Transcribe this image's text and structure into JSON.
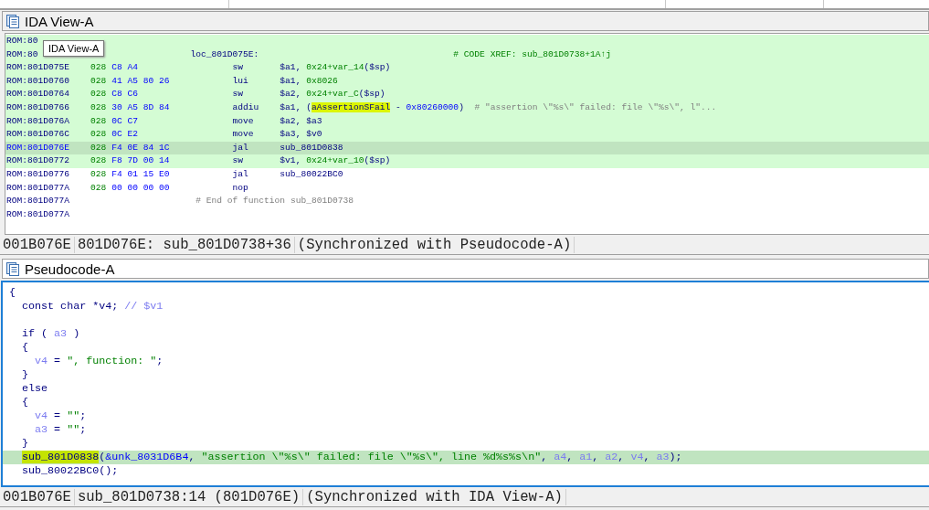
{
  "ida_view": {
    "title": "IDA View-A",
    "active": false,
    "tooltip": "IDA View-A",
    "lines": [
      {
        "kind": "plain",
        "marked": true,
        "selected": false,
        "addr": "ROM:80"
      },
      {
        "kind": "label",
        "marked": true,
        "selected": false,
        "addr": "ROM:80",
        "label": "loc_801D075E:",
        "comment": {
          "kind": "xref",
          "text": "# CODE XREF: sub_801D0738+1A↑j"
        }
      },
      {
        "kind": "insn",
        "marked": true,
        "selected": false,
        "addr": "ROM:801D075E",
        "prefix": "028",
        "bytes": "C8 A4",
        "mnem": "sw",
        "ops": [
          {
            "text": "$a1, ",
            "kind": "reg"
          },
          {
            "text": "0x24+var_14",
            "kind": "num"
          },
          {
            "text": "($sp)",
            "kind": "reg"
          }
        ]
      },
      {
        "kind": "insn",
        "marked": true,
        "selected": false,
        "addr": "ROM:801D0760",
        "prefix": "028",
        "bytes": "41 A5 80 26",
        "mnem": "lui",
        "ops": [
          {
            "text": "$a1, ",
            "kind": "reg"
          },
          {
            "text": "0x8026",
            "kind": "num"
          }
        ]
      },
      {
        "kind": "insn",
        "marked": true,
        "selected": false,
        "addr": "ROM:801D0764",
        "prefix": "028",
        "bytes": "C8 C6",
        "mnem": "sw",
        "ops": [
          {
            "text": "$a2, ",
            "kind": "reg"
          },
          {
            "text": "0x24+var_C",
            "kind": "num"
          },
          {
            "text": "($sp)",
            "kind": "reg"
          }
        ]
      },
      {
        "kind": "insn",
        "marked": true,
        "selected": false,
        "addr": "ROM:801D0766",
        "prefix": "028",
        "bytes": "30 A5 8D 84",
        "mnem": "addiu",
        "ops": [
          {
            "text": "$a1, (",
            "kind": "reg"
          },
          {
            "text": "aAssertionSFail",
            "kind": "reg",
            "highlighted": true
          },
          {
            "text": " - ",
            "kind": "reg"
          },
          {
            "text": "0x80260000",
            "kind": "addr"
          },
          {
            "text": ")",
            "kind": "reg"
          }
        ],
        "comment": {
          "kind": "string",
          "text": "# \"assertion \\\"%s\\\" failed: file \\\"%s\\\", l\"..."
        }
      },
      {
        "kind": "insn",
        "marked": true,
        "selected": false,
        "addr": "ROM:801D076A",
        "prefix": "028",
        "bytes": "0C C7",
        "mnem": "move",
        "ops": [
          {
            "text": "$a2, $a3",
            "kind": "reg"
          }
        ]
      },
      {
        "kind": "insn",
        "marked": true,
        "selected": false,
        "addr": "ROM:801D076C",
        "prefix": "028",
        "bytes": "0C E2",
        "mnem": "move",
        "ops": [
          {
            "text": "$a3, $v0",
            "kind": "reg"
          }
        ]
      },
      {
        "kind": "insn",
        "marked": true,
        "selected": true,
        "addr": "ROM:801D076E",
        "prefix": "028",
        "bytes": "F4 0E 84 1C",
        "mnem": "jal",
        "ops": [
          {
            "text": "sub_801D0838",
            "kind": "reg"
          }
        ]
      },
      {
        "kind": "insn",
        "marked": true,
        "selected": false,
        "addr": "ROM:801D0772",
        "prefix": "028",
        "bytes": "F8 7D 00 14",
        "mnem": "sw",
        "ops": [
          {
            "text": "$v1, ",
            "kind": "reg"
          },
          {
            "text": "0x24+var_10",
            "kind": "num"
          },
          {
            "text": "($sp)",
            "kind": "reg"
          }
        ]
      },
      {
        "kind": "insn",
        "marked": false,
        "selected": false,
        "addr": "ROM:801D0776",
        "prefix": "028",
        "bytes": "F4 01 15 E0",
        "mnem": "jal",
        "ops": [
          {
            "text": "sub_80022BC0",
            "kind": "reg"
          }
        ]
      },
      {
        "kind": "insn",
        "marked": false,
        "selected": false,
        "addr": "ROM:801D077A",
        "prefix": "028",
        "bytes": "00 00 00 00",
        "mnem": "nop"
      },
      {
        "kind": "end",
        "marked": false,
        "selected": false,
        "addr": "ROM:801D077A",
        "comment": {
          "kind": "end",
          "text": "# End of function sub_801D0738"
        }
      },
      {
        "kind": "plain",
        "marked": false,
        "selected": false,
        "addr": "ROM:801D077A"
      }
    ],
    "status": [
      "001B076E",
      "801D076E: sub_801D0738+36",
      "(Synchronized with Pseudocode-A)"
    ]
  },
  "pseudocode": {
    "title": "Pseudocode-A",
    "active": true,
    "lines": [
      {
        "kind": "code",
        "selected": false,
        "tokens": [
          {
            "text": "{",
            "kind": "code"
          }
        ],
        "children": [
          {
            "kind": "code",
            "selected": false,
            "tokens": [
              {
                "text": "const char *v4; ",
                "kind": "code"
              },
              {
                "text": "// $v1",
                "kind": "cmt"
              }
            ]
          },
          {
            "kind": "blank",
            "selected": false
          },
          {
            "kind": "code",
            "selected": false,
            "tokens": [
              {
                "text": "if ( ",
                "kind": "code"
              },
              {
                "text": "a3",
                "kind": "var"
              },
              {
                "text": " )",
                "kind": "code"
              }
            ]
          },
          {
            "kind": "code",
            "selected": false,
            "tokens": [
              {
                "text": "{",
                "kind": "code"
              }
            ],
            "children": [
              {
                "kind": "code",
                "selected": false,
                "tokens": [
                  {
                    "text": "v4",
                    "kind": "var"
                  },
                  {
                    "text": " = ",
                    "kind": "code"
                  },
                  {
                    "text": "\", function: \"",
                    "kind": "str"
                  },
                  {
                    "text": ";",
                    "kind": "code"
                  }
                ]
              }
            ]
          },
          {
            "kind": "code",
            "selected": false,
            "tokens": [
              {
                "text": "}",
                "kind": "code"
              }
            ]
          },
          {
            "kind": "code",
            "selected": false,
            "tokens": [
              {
                "text": "else",
                "kind": "code"
              }
            ]
          },
          {
            "kind": "code",
            "selected": false,
            "tokens": [
              {
                "text": "{",
                "kind": "code"
              }
            ],
            "children": [
              {
                "kind": "code",
                "selected": false,
                "tokens": [
                  {
                    "text": "v4",
                    "kind": "var"
                  },
                  {
                    "text": " = ",
                    "kind": "code"
                  },
                  {
                    "text": "\"\"",
                    "kind": "str"
                  },
                  {
                    "text": ";",
                    "kind": "code"
                  }
                ]
              },
              {
                "kind": "code",
                "selected": false,
                "tokens": [
                  {
                    "text": "a3",
                    "kind": "var"
                  },
                  {
                    "text": " = ",
                    "kind": "code"
                  },
                  {
                    "text": "\"\"",
                    "kind": "str"
                  },
                  {
                    "text": ";",
                    "kind": "code"
                  }
                ]
              }
            ]
          },
          {
            "kind": "code",
            "selected": false,
            "tokens": [
              {
                "text": "}",
                "kind": "code"
              }
            ]
          },
          {
            "kind": "code",
            "selected": true,
            "tokens": [
              {
                "text": "sub_801D0838",
                "kind": "code",
                "highlighted": true
              },
              {
                "text": "(",
                "kind": "code"
              },
              {
                "text": "&unk_8031D6B4",
                "kind": "addr"
              },
              {
                "text": ", ",
                "kind": "code"
              },
              {
                "text": "\"assertion \\\"%s\\\" failed: file \\\"%s\\\", line %d%s%s\\n\"",
                "kind": "str"
              },
              {
                "text": ", ",
                "kind": "code"
              },
              {
                "text": "a4",
                "kind": "var"
              },
              {
                "text": ", ",
                "kind": "code"
              },
              {
                "text": "a1",
                "kind": "var"
              },
              {
                "text": ", ",
                "kind": "code"
              },
              {
                "text": "a2",
                "kind": "var"
              },
              {
                "text": ", ",
                "kind": "code"
              },
              {
                "text": "v4",
                "kind": "var"
              },
              {
                "text": ", ",
                "kind": "code"
              },
              {
                "text": "a3",
                "kind": "var"
              },
              {
                "text": ");",
                "kind": "code"
              }
            ]
          },
          {
            "kind": "code",
            "selected": false,
            "tokens": [
              {
                "text": "sub_80022BC0();",
                "kind": "code"
              }
            ]
          }
        ]
      }
    ],
    "status": [
      "001B076E",
      "sub_801D0738:14 (801D076E)",
      "(Synchronized with IDA View-A)"
    ]
  }
}
